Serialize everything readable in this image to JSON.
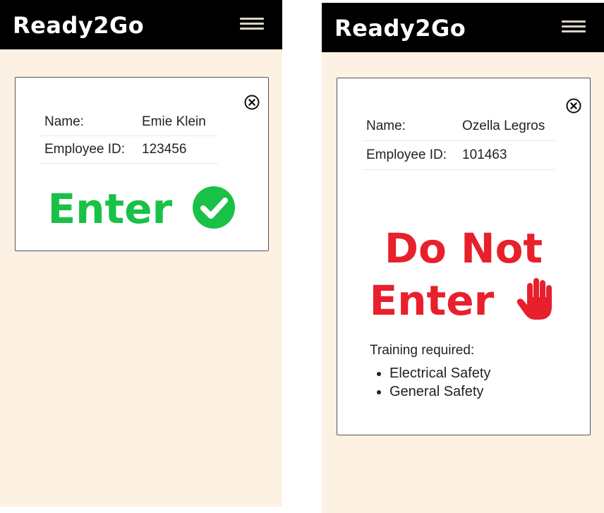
{
  "left": {
    "brand": "Ready2Go",
    "name_label": "Name:",
    "name_value": "Emie Klein",
    "id_label": "Employee ID:",
    "id_value": "123456",
    "status": "Enter",
    "status_color": "#19c146",
    "status_icon": "check-circle-icon"
  },
  "right": {
    "brand": "Ready2Go",
    "name_label": "Name:",
    "name_value": "Ozella Legros",
    "id_label": "Employee ID:",
    "id_value": "101463",
    "status_line1": "Do Not",
    "status_line2": "Enter",
    "status_color": "#e8202c",
    "status_icon": "stop-hand-icon",
    "training_label": "Training required:",
    "training_items": [
      "Electrical Safety",
      "General Safety"
    ]
  },
  "colors": {
    "header_bg": "#000000",
    "page_bg": "#fdf1e4"
  }
}
